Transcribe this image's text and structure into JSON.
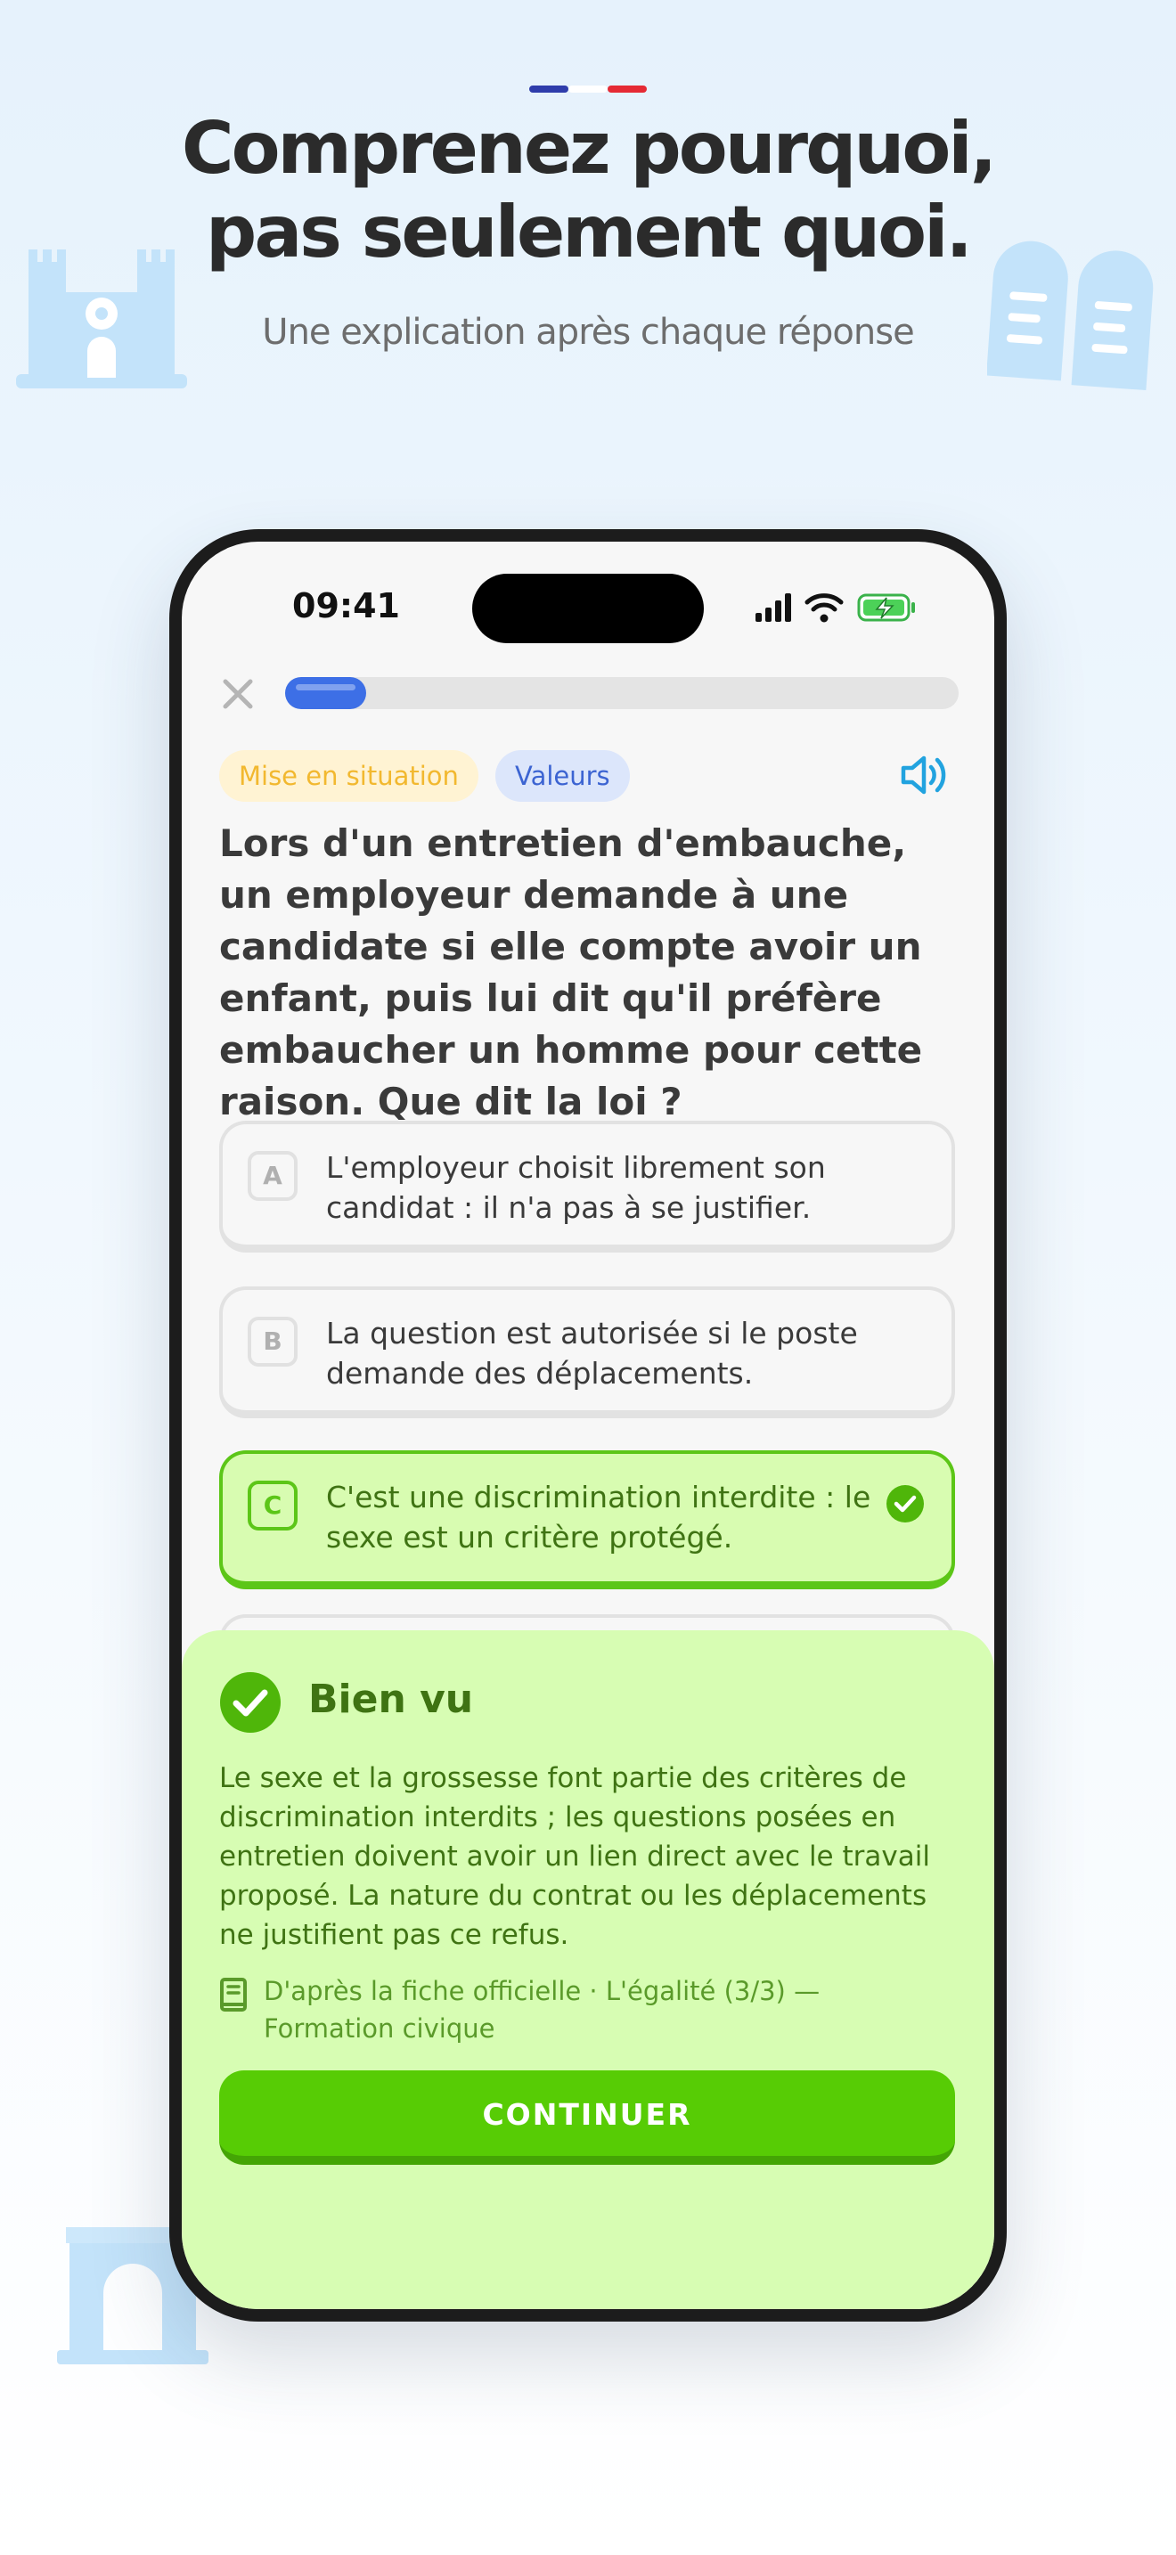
{
  "header": {
    "flag_colors": [
      "#2f3dab",
      "#ffffff",
      "#e52a34"
    ],
    "headline_lines": [
      "Comprenez pourquoi,",
      "pas seulement quoi."
    ],
    "subtitle": "Une explication après chaque réponse"
  },
  "status_bar": {
    "time": "09:41",
    "icons": [
      "signal-icon",
      "wifi-icon",
      "battery-charging-icon"
    ]
  },
  "quiz": {
    "progress_fraction": 0.12,
    "tags": [
      "Mise en situation",
      "Valeurs"
    ],
    "question": "Lors d'un entretien d'embauche, un employeur demande à une candidate si elle compte avoir un enfant, puis lui dit qu'il préfère embaucher un homme pour cette raison. Que dit la loi ?",
    "options": [
      {
        "letter": "A",
        "text": "L'employeur choisit librement son candidat : il n'a pas à se justifier."
      },
      {
        "letter": "B",
        "text": "La question est autorisée si le poste demande des déplacements."
      },
      {
        "letter": "C",
        "text": "C'est une discrimination interdite : le sexe est un critère protégé.",
        "state": "correct"
      }
    ]
  },
  "feedback": {
    "title": "Bien vu",
    "body": "Le sexe et la grossesse font partie des critères de discrimination interdits ; les questions posées en entretien doivent avoir un lien direct avec le travail proposé. La nature du contrat ou les déplacements ne justifient pas ce refus.",
    "source": "D'après la fiche officielle · L'égalité (3/3) — Formation civique",
    "continue_label": "CONTINUER"
  },
  "colors": {
    "accent_blue": "#3d6fe6",
    "correct_green": "#57cc05",
    "correct_bg": "#d7fdb3",
    "tag_yellow_text": "#f2b82f",
    "tag_blue_text": "#3c64d2"
  }
}
